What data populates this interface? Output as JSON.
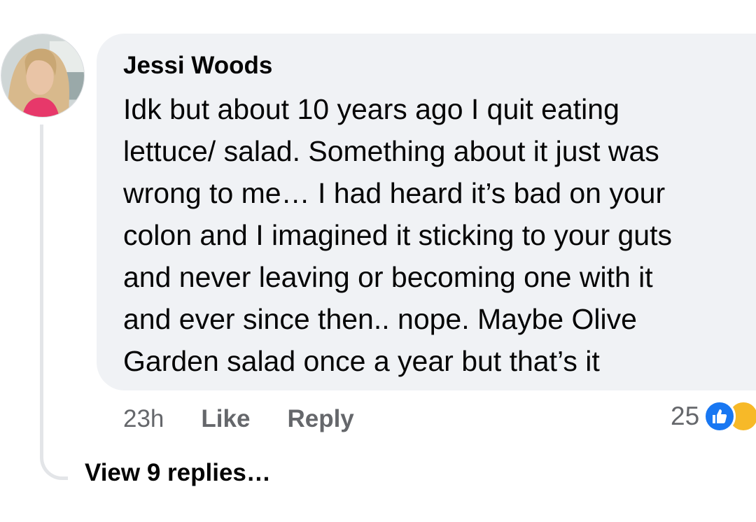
{
  "comment": {
    "author": "Jessi Woods",
    "text_lines": [
      "Idk but about 10 years ago I quit eating",
      "lettuce/ salad. Something about it just was",
      "wrong to me… I had heard it’s bad on your",
      "colon and I imagined it sticking to your guts",
      "and never leaving or becoming one with it",
      "and ever since then.. nope. Maybe Olive",
      "Garden salad once a year but that’s it"
    ],
    "time": "23h",
    "like_label": "Like",
    "reply_label": "Reply",
    "reaction_count": "25",
    "reaction_icons": [
      "thumbs-up-icon",
      "reaction-icon"
    ],
    "avatar_icon": "profile-photo"
  },
  "replies": {
    "view_label": "View 9 replies…"
  },
  "colors": {
    "bubble": "#f0f2f5",
    "thread_line": "#e3e5e8",
    "meta_text": "#65676b",
    "like_blue": "#1877f2",
    "body_text": "#050505"
  }
}
